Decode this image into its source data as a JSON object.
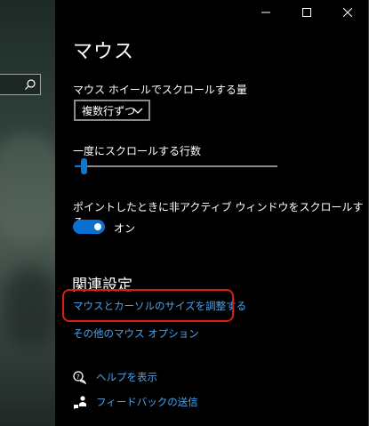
{
  "page": {
    "title": "マウス"
  },
  "scroll": {
    "wheel_label": "マウス ホイールでスクロールする量",
    "wheel_value": "複数行ずつ",
    "lines_label": "一度にスクロールする行数",
    "lines_slider_fraction": 0.03
  },
  "inactive": {
    "label": "ポイントしたときに非アクティブ ウィンドウをスクロールする",
    "toggle_state": "オン"
  },
  "related": {
    "heading": "関連設定",
    "links": [
      "マウスとカーソルのサイズを調整する",
      "その他のマウス オプション"
    ]
  },
  "help": {
    "show_help": "ヘルプを表示",
    "feedback": "フィードバックの送信"
  },
  "colors": {
    "accent": "#0a78d7",
    "link": "#4aa3f0",
    "highlight": "#e01818",
    "background": "#000000"
  }
}
